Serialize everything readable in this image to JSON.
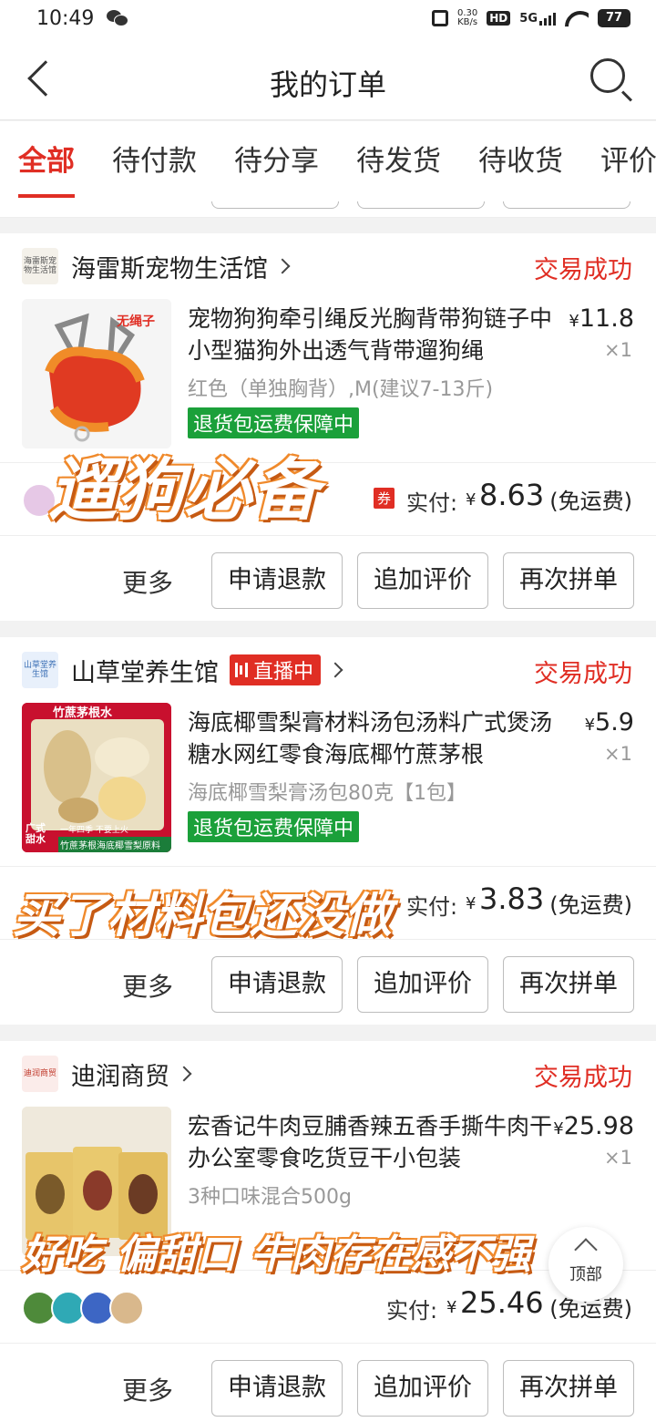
{
  "status_bar": {
    "time": "10:49",
    "net_speed_value": "0.30",
    "net_speed_unit": "KB/s",
    "hd": "HD",
    "network": "5G",
    "battery": "77"
  },
  "header": {
    "title": "我的订单"
  },
  "tabs": [
    {
      "label": "全部",
      "active": true
    },
    {
      "label": "待付款"
    },
    {
      "label": "待分享"
    },
    {
      "label": "待发货"
    },
    {
      "label": "待收货"
    },
    {
      "label": "评价"
    }
  ],
  "orders": [
    {
      "shop": {
        "name": "海雷斯宠物生活馆",
        "logo_text": "海雷斯宠物生活馆"
      },
      "status": "交易成功",
      "product": {
        "title": "宠物狗狗牵引绳反光胸背带狗链子中小型猫狗外出透气背带遛狗绳",
        "price_yen": "¥",
        "price": "11.8",
        "qty": "×1",
        "spec": "红色（单独胸背）,M(建议7-13斤)",
        "guarantee": "退货包运费保障中",
        "thumb_badge": "无绳子"
      },
      "payment": {
        "coupon": "券",
        "label": "实付:",
        "yen": "¥",
        "amount": "8.63",
        "note": "(免运费)"
      },
      "actions": {
        "more": "更多",
        "refund": "申请退款",
        "review": "追加评价",
        "reorder": "再次拼单"
      },
      "overlay": "遛狗必备"
    },
    {
      "shop": {
        "name": "山草堂养生馆",
        "logo_text": "山草堂养生馆",
        "live": "直播中"
      },
      "status": "交易成功",
      "product": {
        "title": "海底椰雪梨膏材料汤包汤料广式煲汤糖水网红零食海底椰竹蔗茅根",
        "price_yen": "¥",
        "price": "5.9",
        "qty": "×1",
        "spec": "海底椰雪梨膏汤包80克【1包】",
        "guarantee": "退货包运费保障中",
        "thumb_top": "竹蔗茅根水",
        "thumb_left": "广式甜水",
        "thumb_bottom": "竹蔗茅根海底椰雪梨原料",
        "thumb_sub": "一年四季 不要上火"
      },
      "payment": {
        "label": "实付:",
        "yen": "¥",
        "amount": "3.83",
        "note": "(免运费)"
      },
      "actions": {
        "more": "更多",
        "refund": "申请退款",
        "review": "追加评价",
        "reorder": "再次拼单"
      },
      "overlay": "买了材料包还没做"
    },
    {
      "shop": {
        "name": "迪润商贸",
        "logo_text": "迪润商贸"
      },
      "status": "交易成功",
      "product": {
        "title": "宏香记牛肉豆脯香辣五香手撕牛肉干办公室零食吃货豆干小包装",
        "price_yen": "¥",
        "price": "25.98",
        "qty": "×1",
        "spec": "3种口味混合500g"
      },
      "payment": {
        "label": "实付:",
        "yen": "¥",
        "amount": "25.46",
        "note": "(免运费)"
      },
      "actions": {
        "more": "更多",
        "refund": "申请退款",
        "review": "追加评价",
        "reorder": "再次拼单"
      },
      "overlay": "好吃 偏甜口 牛肉存在感不强"
    }
  ],
  "float_button": {
    "label": "顶部"
  },
  "colors": {
    "accent": "#e02e24",
    "guarantee": "#1ba03a",
    "overlay_stroke": "#e8711f"
  }
}
